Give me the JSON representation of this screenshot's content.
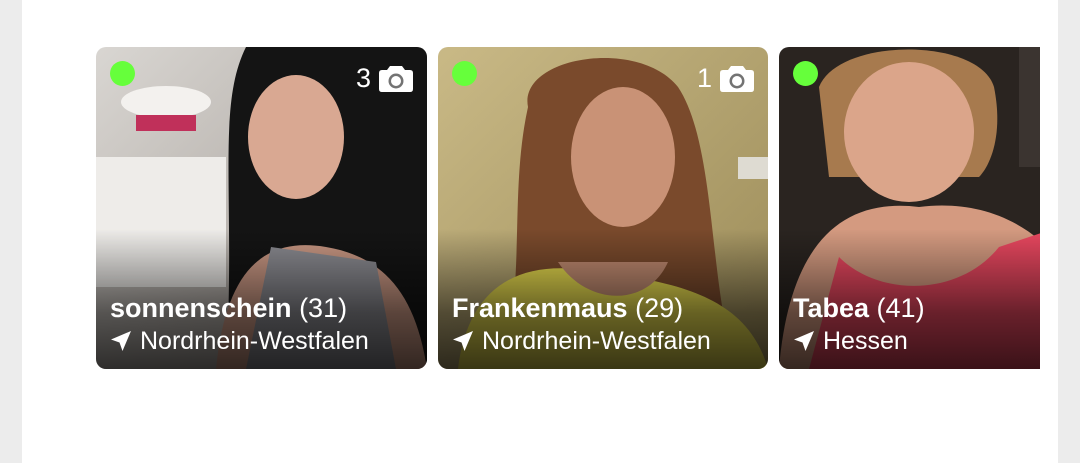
{
  "colors": {
    "online": "#66ff3b",
    "page_bg": "#ececec",
    "panel_bg": "#ffffff",
    "text": "#ffffff"
  },
  "cards": [
    {
      "name": "sonnenschein",
      "age": "(31)",
      "location": "Nordrhein-Westfalen",
      "photo_count": "3",
      "online": true,
      "photo_icon": "camera-icon",
      "location_icon": "location-arrow-icon"
    },
    {
      "name": "Frankenmaus",
      "age": "(29)",
      "location": "Nordrhein-Westfalen",
      "photo_count": "1",
      "online": true,
      "photo_icon": "camera-icon",
      "location_icon": "location-arrow-icon"
    },
    {
      "name": "Tabea",
      "age": "(41)",
      "location": "Hessen",
      "photo_count": "",
      "online": true,
      "location_icon": "location-arrow-icon"
    }
  ]
}
